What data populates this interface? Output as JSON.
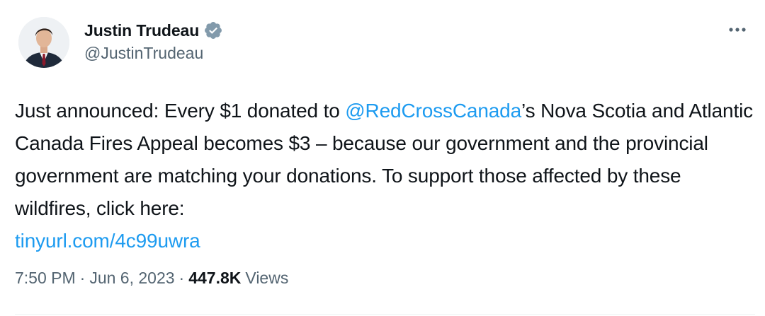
{
  "author": {
    "display_name": "Justin Trudeau",
    "handle": "@JustinTrudeau",
    "verified_badge_icon": "verified-badge-icon",
    "avatar_icon": "profile-photo"
  },
  "more_icon": "more-horizontal-icon",
  "tweet": {
    "text_before_mention": "Just announced: Every $1 donated to ",
    "mention": "@RedCrossCanada",
    "text_after_mention": "’s Nova Scotia and Atlantic Canada Fires Appeal becomes $3 – because our government and the provincial government are matching your donations. To support those affected by these wildfires, click here:",
    "link": "tinyurl.com/4c99uwra"
  },
  "meta": {
    "time": "7:50 PM",
    "separator": "·",
    "date": "Jun 6, 2023",
    "views_count": "447.8K",
    "views_label": "Views"
  },
  "colors": {
    "link": "#1d9bf0",
    "secondary_text": "#536471",
    "primary_text": "#0f1419",
    "verified_badge": "#829aab"
  }
}
